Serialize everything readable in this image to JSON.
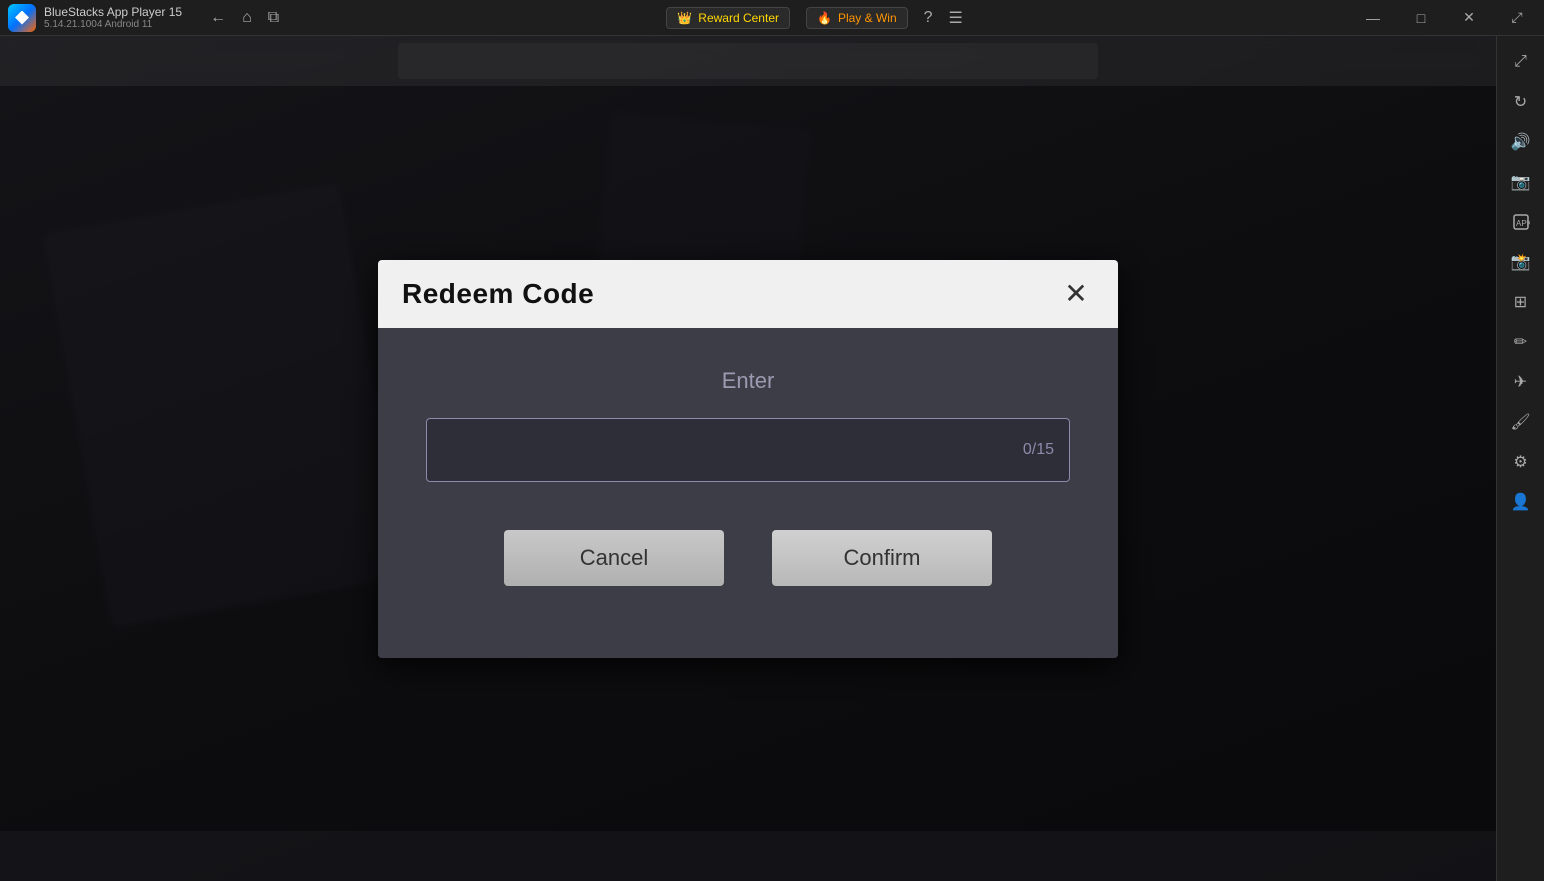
{
  "titlebar": {
    "app_name": "BlueStacks App Player 15",
    "app_version": "5.14.21.1004  Android 11",
    "reward_center_label": "Reward Center",
    "play_win_label": "Play & Win",
    "nav": {
      "back": "←",
      "home": "⌂",
      "copy": "⧉"
    },
    "window_controls": {
      "minimize": "—",
      "maximize": "□",
      "close": "✕",
      "restore": "⤢"
    }
  },
  "sidebar": {
    "icons": [
      {
        "name": "expand-icon",
        "symbol": "⤢"
      },
      {
        "name": "rotate-icon",
        "symbol": "↻"
      },
      {
        "name": "volume-icon",
        "symbol": "🔊"
      },
      {
        "name": "camera-icon",
        "symbol": "📷"
      },
      {
        "name": "apk-icon",
        "symbol": "📦"
      },
      {
        "name": "screenshot-icon",
        "symbol": "📸"
      },
      {
        "name": "resize-icon",
        "symbol": "⊞"
      },
      {
        "name": "edit-icon",
        "symbol": "✏"
      },
      {
        "name": "flight-icon",
        "symbol": "✈"
      },
      {
        "name": "brush-icon",
        "symbol": "🖌"
      },
      {
        "name": "settings-icon",
        "symbol": "⚙"
      },
      {
        "name": "profile-icon",
        "symbol": "👤"
      }
    ]
  },
  "dialog": {
    "title": "Redeem Code",
    "close_label": "✕",
    "enter_label": "Enter",
    "input_placeholder": "",
    "input_counter": "0/15",
    "cancel_label": "Cancel",
    "confirm_label": "Confirm"
  }
}
